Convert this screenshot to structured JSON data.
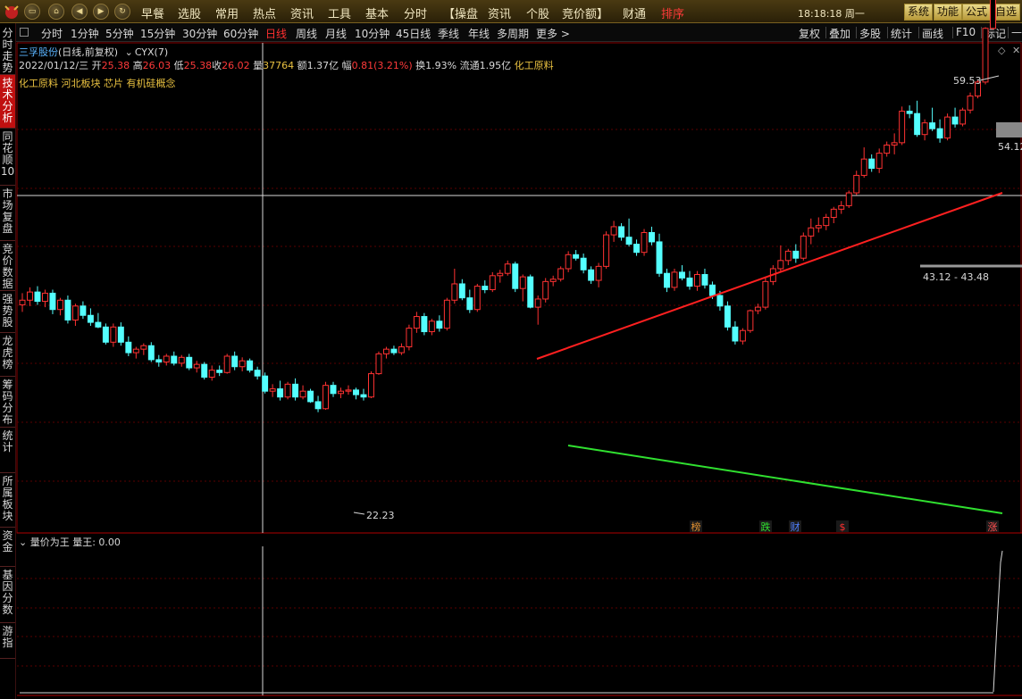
{
  "topbar": {
    "menu": [
      "早餐",
      "选股",
      "常用",
      "热点",
      "资讯",
      "工具",
      "基本",
      "分时",
      "【操盘",
      "资讯",
      "个股",
      "竞价额】",
      "财通",
      "排序"
    ],
    "clock": "18:18:18 周一",
    "buttons": [
      "系统",
      "功能",
      "公式",
      "自选"
    ]
  },
  "period_bar": {
    "items": [
      "分时",
      "1分钟",
      "5分钟",
      "15分钟",
      "30分钟",
      "60分钟",
      "日线",
      "周线",
      "月线",
      "10分钟",
      "45日线",
      "季线",
      "年线",
      "多周期",
      "更多 >"
    ],
    "active": "日线",
    "right_items": [
      "复权",
      "叠加",
      "多股",
      "统计",
      "画线",
      "F10",
      "标记",
      "—"
    ]
  },
  "sidebar": {
    "tabs": [
      "分时走势",
      "技术分析",
      "同花顺10",
      "市场复盘",
      "竞价数据",
      "强势股",
      "龙虎榜",
      "筹码分布",
      "统计",
      "所属板块",
      "资金",
      "基因分数",
      "游指"
    ],
    "active": "技术分析"
  },
  "stock": {
    "name": "三孚股份",
    "mode": "(日线,前复权)",
    "indicator": "CYX(7)",
    "date": "2022/01/12/三",
    "open_label": "开",
    "open": "25.38",
    "high_label": "高",
    "high": "26.03",
    "low_label": "低",
    "low": "25.38",
    "close_label": "收",
    "close": "26.02",
    "volume_label": "量",
    "volume": "37764",
    "amount_label": "额",
    "amount": "1.37亿",
    "change_label": "幅",
    "change": "0.81(3.21%)",
    "turnover_label": "换",
    "turnover": "1.93%",
    "float_label": "流通",
    "float_cap": "1.95亿",
    "industry": "化工原料",
    "concepts": "化工原料 河北板块 芯片 有机硅概念"
  },
  "annotations": {
    "high_price": "59.53",
    "right_price": "54.12",
    "range_label": "43.12 - 43.48",
    "low_price": "22.23"
  },
  "markers": [
    {
      "text": "榜",
      "color": "#e09030"
    },
    {
      "text": "跌",
      "color": "#30e030"
    },
    {
      "text": "财",
      "color": "#5080ff"
    },
    {
      "text": "$",
      "color": "#ff3030"
    },
    {
      "text": "涨",
      "color": "#ff5050"
    }
  ],
  "subpanel": {
    "title": "量价为王",
    "indicator": "量王: 0.00"
  },
  "colors": {
    "up": "#ff3232",
    "down": "#54ffff",
    "resistance": "#ff2020",
    "support": "#30e030",
    "grid": "#5a0000"
  },
  "chart_data": {
    "type": "candlestick",
    "price_range": [
      19.8,
      61.2
    ],
    "candles": [
      [
        39.2,
        40.2,
        38.6,
        39.6
      ],
      [
        39.6,
        40.7,
        39.1,
        40.3
      ],
      [
        40.3,
        40.8,
        39.2,
        39.5
      ],
      [
        39.5,
        40.5,
        39.0,
        40.2
      ],
      [
        40.2,
        40.5,
        38.4,
        38.8
      ],
      [
        38.8,
        39.8,
        38.3,
        39.6
      ],
      [
        39.6,
        40.0,
        37.6,
        37.9
      ],
      [
        37.9,
        39.3,
        37.4,
        39.1
      ],
      [
        39.1,
        39.5,
        38.0,
        38.3
      ],
      [
        38.3,
        38.9,
        37.4,
        37.7
      ],
      [
        37.7,
        38.5,
        37.2,
        37.3
      ],
      [
        37.3,
        37.6,
        35.8,
        36.0
      ],
      [
        36.0,
        37.6,
        35.6,
        37.3
      ],
      [
        37.3,
        37.7,
        35.7,
        36.0
      ],
      [
        36.0,
        36.5,
        34.8,
        35.1
      ],
      [
        35.1,
        35.6,
        34.6,
        35.4
      ],
      [
        35.4,
        35.9,
        34.9,
        35.7
      ],
      [
        35.7,
        36.0,
        34.3,
        34.5
      ],
      [
        34.5,
        34.9,
        33.9,
        34.3
      ],
      [
        34.3,
        35.0,
        34.0,
        34.8
      ],
      [
        34.8,
        35.2,
        34.0,
        34.2
      ],
      [
        34.2,
        34.9,
        33.9,
        34.7
      ],
      [
        34.7,
        35.0,
        33.6,
        33.8
      ],
      [
        33.8,
        34.4,
        33.4,
        34.1
      ],
      [
        34.1,
        34.3,
        32.8,
        33.0
      ],
      [
        33.0,
        34.0,
        32.7,
        33.6
      ],
      [
        33.6,
        34.0,
        33.1,
        33.4
      ],
      [
        33.4,
        35.0,
        33.3,
        34.8
      ],
      [
        34.8,
        35.2,
        33.6,
        33.9
      ],
      [
        33.9,
        34.7,
        33.5,
        34.4
      ],
      [
        34.4,
        34.6,
        33.4,
        33.6
      ],
      [
        33.6,
        33.9,
        32.8,
        33.1
      ],
      [
        33.1,
        33.4,
        31.6,
        31.8
      ],
      [
        31.8,
        32.4,
        31.3,
        32.0
      ],
      [
        32.0,
        32.7,
        31.0,
        31.3
      ],
      [
        31.3,
        32.6,
        31.1,
        32.4
      ],
      [
        32.4,
        32.9,
        31.0,
        31.3
      ],
      [
        31.3,
        32.3,
        31.1,
        31.8
      ],
      [
        31.8,
        32.0,
        30.8,
        30.9
      ],
      [
        30.9,
        31.4,
        30.0,
        30.3
      ],
      [
        30.3,
        32.6,
        30.2,
        32.3
      ],
      [
        32.3,
        32.6,
        31.3,
        31.6
      ],
      [
        31.6,
        32.1,
        31.2,
        31.8
      ],
      [
        31.8,
        32.3,
        31.5,
        31.9
      ],
      [
        31.9,
        32.1,
        31.1,
        31.5
      ],
      [
        31.5,
        32.0,
        31.0,
        31.3
      ],
      [
        31.3,
        33.5,
        31.2,
        33.3
      ],
      [
        33.3,
        35.2,
        33.2,
        35.0
      ],
      [
        35.0,
        35.6,
        34.6,
        35.4
      ],
      [
        35.4,
        35.7,
        34.9,
        35.1
      ],
      [
        35.1,
        35.9,
        34.9,
        35.6
      ],
      [
        35.6,
        37.5,
        35.3,
        37.2
      ],
      [
        37.2,
        38.6,
        36.8,
        38.2
      ],
      [
        38.2,
        38.5,
        36.6,
        36.9
      ],
      [
        36.9,
        38.0,
        36.6,
        37.8
      ],
      [
        37.8,
        38.3,
        36.9,
        37.2
      ],
      [
        37.2,
        39.8,
        37.0,
        39.6
      ],
      [
        39.6,
        42.3,
        39.3,
        41.0
      ],
      [
        41.0,
        41.4,
        39.6,
        39.8
      ],
      [
        39.8,
        40.5,
        38.5,
        38.8
      ],
      [
        38.8,
        41.0,
        38.6,
        40.8
      ],
      [
        40.8,
        41.3,
        40.2,
        40.5
      ],
      [
        40.5,
        42.0,
        40.3,
        41.7
      ],
      [
        41.7,
        42.2,
        41.1,
        41.9
      ],
      [
        41.9,
        43.0,
        41.7,
        42.7
      ],
      [
        42.7,
        42.9,
        40.3,
        40.6
      ],
      [
        40.6,
        41.8,
        39.5,
        41.6
      ],
      [
        41.6,
        41.8,
        38.9,
        39.0
      ],
      [
        39.0,
        40.0,
        37.5,
        39.7
      ],
      [
        39.7,
        41.5,
        39.4,
        41.2
      ],
      [
        41.2,
        41.7,
        40.8,
        41.4
      ],
      [
        41.4,
        42.5,
        41.2,
        42.3
      ],
      [
        42.3,
        43.8,
        42.0,
        43.5
      ],
      [
        43.5,
        43.9,
        43.0,
        43.2
      ],
      [
        43.2,
        43.6,
        41.9,
        42.2
      ],
      [
        42.2,
        42.5,
        41.0,
        41.3
      ],
      [
        41.3,
        42.8,
        40.7,
        42.5
      ],
      [
        42.5,
        45.5,
        42.3,
        45.2
      ],
      [
        45.2,
        46.4,
        44.6,
        45.9
      ],
      [
        45.9,
        46.2,
        44.7,
        45.0
      ],
      [
        45.0,
        46.6,
        44.2,
        44.4
      ],
      [
        44.4,
        44.8,
        43.4,
        43.7
      ],
      [
        43.7,
        45.7,
        43.4,
        45.4
      ],
      [
        45.4,
        45.9,
        44.3,
        44.6
      ],
      [
        44.6,
        45.3,
        41.6,
        41.9
      ],
      [
        41.9,
        42.3,
        40.3,
        40.7
      ],
      [
        40.7,
        42.3,
        40.4,
        42.0
      ],
      [
        42.0,
        42.6,
        41.3,
        41.5
      ],
      [
        41.5,
        42.1,
        40.5,
        40.8
      ],
      [
        40.8,
        42.1,
        40.4,
        41.8
      ],
      [
        41.8,
        42.3,
        40.6,
        40.9
      ],
      [
        40.9,
        41.2,
        39.7,
        40.0
      ],
      [
        40.0,
        40.4,
        38.7,
        39.1
      ],
      [
        39.1,
        39.5,
        37.0,
        37.3
      ],
      [
        37.3,
        37.8,
        35.8,
        36.1
      ],
      [
        36.1,
        37.2,
        35.8,
        37.0
      ],
      [
        37.0,
        38.8,
        36.8,
        38.7
      ],
      [
        38.7,
        39.3,
        38.4,
        39.0
      ],
      [
        39.0,
        41.5,
        38.8,
        41.2
      ],
      [
        41.2,
        42.6,
        40.9,
        42.3
      ],
      [
        42.3,
        44.3,
        42.0,
        43.0
      ],
      [
        43.0,
        44.0,
        42.6,
        43.8
      ],
      [
        43.8,
        44.4,
        42.8,
        43.2
      ],
      [
        43.2,
        45.4,
        43.0,
        45.1
      ],
      [
        45.1,
        46.6,
        44.4,
        45.8
      ],
      [
        45.8,
        46.7,
        45.4,
        46.0
      ],
      [
        46.0,
        47.0,
        45.6,
        46.7
      ],
      [
        46.7,
        47.6,
        46.2,
        47.4
      ],
      [
        47.4,
        48.1,
        47.0,
        47.7
      ],
      [
        47.7,
        49.0,
        47.5,
        48.8
      ],
      [
        48.8,
        50.7,
        48.6,
        50.3
      ],
      [
        50.3,
        52.7,
        50.1,
        51.7
      ],
      [
        51.7,
        52.1,
        50.6,
        50.9
      ],
      [
        50.9,
        52.6,
        50.5,
        52.2
      ],
      [
        52.2,
        53.2,
        51.9,
        52.9
      ],
      [
        52.9,
        53.9,
        52.1,
        53.1
      ],
      [
        53.1,
        56.2,
        52.9,
        55.8
      ],
      [
        55.8,
        56.3,
        55.2,
        55.6
      ],
      [
        55.6,
        56.7,
        53.6,
        53.8
      ],
      [
        53.8,
        55.1,
        53.3,
        54.8
      ],
      [
        54.8,
        56.1,
        54.1,
        54.3
      ],
      [
        54.3,
        55.1,
        53.1,
        53.5
      ],
      [
        53.5,
        55.6,
        53.3,
        55.3
      ],
      [
        55.3,
        56.1,
        54.4,
        54.7
      ],
      [
        54.7,
        56.1,
        54.5,
        55.9
      ],
      [
        55.9,
        57.4,
        55.6,
        57.1
      ],
      [
        57.1,
        58.5,
        56.9,
        58.3
      ],
      [
        58.3,
        63.0,
        58.1,
        62.9
      ],
      [
        62.9,
        68.9,
        62.8,
        68.9
      ],
      [
        68.9,
        75.8,
        68.7,
        75.8
      ]
    ]
  }
}
